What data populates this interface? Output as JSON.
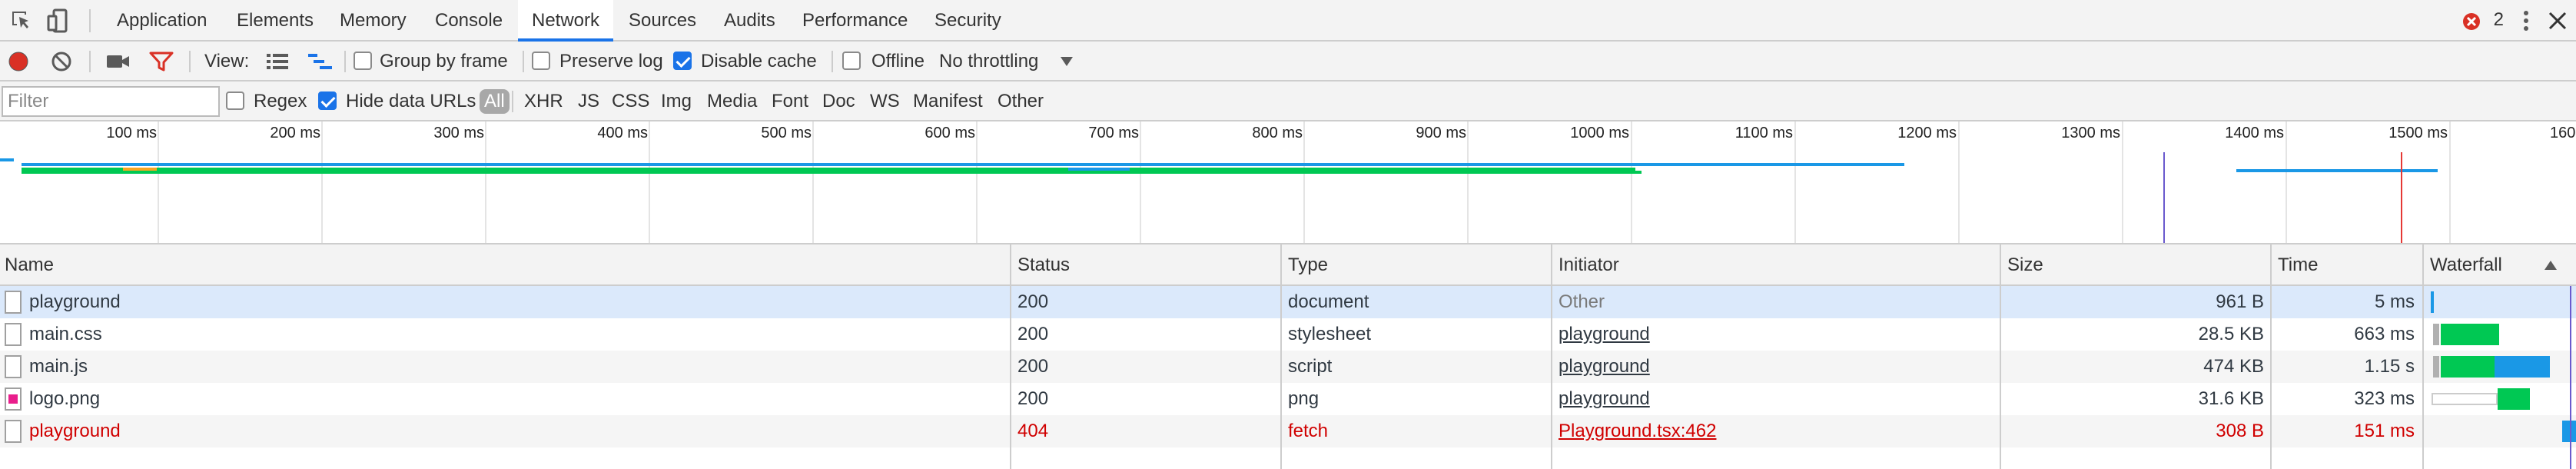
{
  "tabs": [
    {
      "label": "Application",
      "active": false
    },
    {
      "label": "Elements",
      "active": false
    },
    {
      "label": "Memory",
      "active": false
    },
    {
      "label": "Console",
      "active": false
    },
    {
      "label": "Network",
      "active": true
    },
    {
      "label": "Sources",
      "active": false
    },
    {
      "label": "Audits",
      "active": false
    },
    {
      "label": "Performance",
      "active": false
    },
    {
      "label": "Security",
      "active": false
    }
  ],
  "error_count": "2",
  "toolbar": {
    "view_label": "View:",
    "group_by_frame": {
      "label": "Group by frame",
      "checked": false
    },
    "preserve_log": {
      "label": "Preserve log",
      "checked": false
    },
    "disable_cache": {
      "label": "Disable cache",
      "checked": true
    },
    "offline": {
      "label": "Offline",
      "checked": false
    },
    "throttling": "No throttling"
  },
  "filter": {
    "placeholder": "Filter",
    "regex": {
      "label": "Regex",
      "checked": false
    },
    "hide_data_urls": {
      "label": "Hide data URLs",
      "checked": true
    },
    "types": [
      {
        "label": "All",
        "selected": true
      },
      {
        "label": "XHR",
        "selected": false
      },
      {
        "label": "JS",
        "selected": false
      },
      {
        "label": "CSS",
        "selected": false
      },
      {
        "label": "Img",
        "selected": false
      },
      {
        "label": "Media",
        "selected": false
      },
      {
        "label": "Font",
        "selected": false
      },
      {
        "label": "Doc",
        "selected": false
      },
      {
        "label": "WS",
        "selected": false
      },
      {
        "label": "Manifest",
        "selected": false
      },
      {
        "label": "Other",
        "selected": false
      }
    ]
  },
  "overview_ticks": [
    "100 ms",
    "200 ms",
    "300 ms",
    "400 ms",
    "500 ms",
    "600 ms",
    "700 ms",
    "800 ms",
    "900 ms",
    "1000 ms",
    "1100 ms",
    "1200 ms",
    "1300 ms",
    "1400 ms",
    "1500 ms",
    "160"
  ],
  "columns": {
    "name": "Name",
    "status": "Status",
    "type": "Type",
    "initiator": "Initiator",
    "size": "Size",
    "time": "Time",
    "waterfall": "Waterfall"
  },
  "requests": [
    {
      "name": "playground",
      "status": "200",
      "type": "document",
      "initiator": "Other",
      "initiator_link": false,
      "size": "961 B",
      "time": "5 ms",
      "error": false,
      "icon": "document-icon"
    },
    {
      "name": "main.css",
      "status": "200",
      "type": "stylesheet",
      "initiator": "playground",
      "initiator_link": true,
      "size": "28.5 KB",
      "time": "663 ms",
      "error": false,
      "icon": "document-icon"
    },
    {
      "name": "main.js",
      "status": "200",
      "type": "script",
      "initiator": "playground",
      "initiator_link": true,
      "size": "474 KB",
      "time": "1.15 s",
      "error": false,
      "icon": "document-icon"
    },
    {
      "name": "logo.png",
      "status": "200",
      "type": "png",
      "initiator": "playground",
      "initiator_link": true,
      "size": "31.6 KB",
      "time": "323 ms",
      "error": false,
      "icon": "image-icon"
    },
    {
      "name": "playground",
      "status": "404",
      "type": "fetch",
      "initiator": "Playground.tsx:462",
      "initiator_link": true,
      "size": "308 B",
      "time": "151 ms",
      "error": true,
      "icon": "document-icon"
    }
  ],
  "colors": {
    "accent": "#1a73e8",
    "error": "#d00000",
    "record": "#d93025",
    "filter_icon": "#d93025",
    "waterfall_green": "#00c853",
    "waterfall_blue": "#1a98e6",
    "selected_row": "#dbe9fb",
    "striped_row": "#f5f5f5"
  }
}
